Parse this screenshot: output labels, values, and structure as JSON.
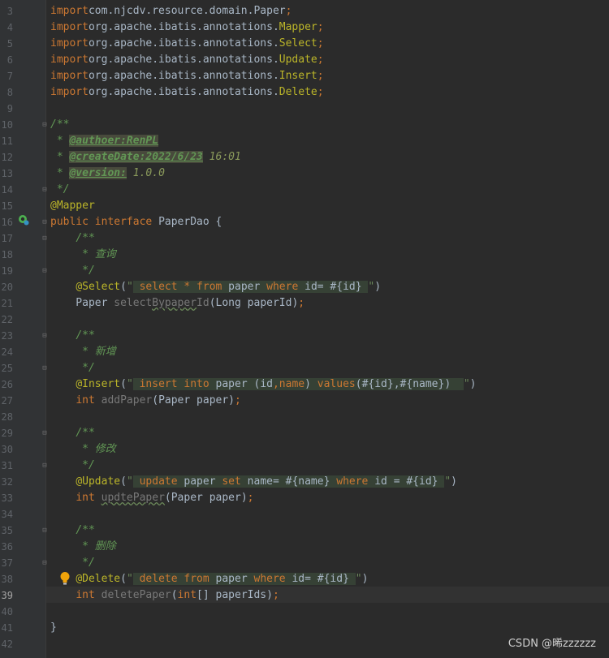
{
  "editor": {
    "lines": [
      {
        "n": "3",
        "parts": [
          [
            "kw",
            "import"
          ],
          [
            "",
            "com.njcdv.resource.domain.Paper"
          ],
          [
            "kw",
            ";"
          ]
        ]
      },
      {
        "n": "4",
        "parts": [
          [
            "kw",
            "import"
          ],
          [
            "",
            "org.apache.ibatis.annotations."
          ],
          [
            "ann",
            "Mapper"
          ],
          [
            "kw",
            ";"
          ]
        ]
      },
      {
        "n": "5",
        "parts": [
          [
            "kw",
            "import"
          ],
          [
            "",
            "org.apache.ibatis.annotations."
          ],
          [
            "ann",
            "Select"
          ],
          [
            "kw",
            ";"
          ]
        ]
      },
      {
        "n": "6",
        "parts": [
          [
            "kw",
            "import"
          ],
          [
            "",
            "org.apache.ibatis.annotations."
          ],
          [
            "ann",
            "Update"
          ],
          [
            "kw",
            ";"
          ]
        ]
      },
      {
        "n": "7",
        "parts": [
          [
            "kw",
            "import"
          ],
          [
            "",
            "org.apache.ibatis.annotations."
          ],
          [
            "ann",
            "Insert"
          ],
          [
            "kw",
            ";"
          ]
        ]
      },
      {
        "n": "8",
        "parts": [
          [
            "kw",
            "import"
          ],
          [
            "",
            "org.apache.ibatis.annotations."
          ],
          [
            "ann",
            "Delete"
          ],
          [
            "kw",
            ";"
          ]
        ]
      },
      {
        "n": "9",
        "parts": []
      },
      {
        "n": "10",
        "fold": true,
        "parts": [
          [
            "doc",
            "/**"
          ]
        ]
      },
      {
        "n": "11",
        "parts": [
          [
            "doc",
            " * "
          ],
          [
            "doctag",
            "@authoer:RenPL"
          ]
        ]
      },
      {
        "n": "12",
        "parts": [
          [
            "doc",
            " * "
          ],
          [
            "doctag",
            "@createDate:2022/6/23"
          ],
          [
            "docval",
            " 16:01"
          ]
        ]
      },
      {
        "n": "13",
        "parts": [
          [
            "doc",
            " * "
          ],
          [
            "doctag",
            "@version:"
          ],
          [
            "docval",
            " 1.0.0"
          ]
        ]
      },
      {
        "n": "14",
        "fold": true,
        "parts": [
          [
            "doc",
            " */"
          ]
        ]
      },
      {
        "n": "15",
        "parts": [
          [
            "ann",
            "@Mapper"
          ]
        ]
      },
      {
        "n": "16",
        "fold": true,
        "parts": [
          [
            "kw",
            "public interface "
          ],
          [
            "",
            "PaperDao {"
          ]
        ]
      },
      {
        "n": "17",
        "fold": true,
        "parts": [
          [
            "",
            "    "
          ],
          [
            "doc",
            "/**"
          ]
        ]
      },
      {
        "n": "18",
        "parts": [
          [
            "",
            "    "
          ],
          [
            "doc",
            " * 查询"
          ]
        ]
      },
      {
        "n": "19",
        "fold": true,
        "parts": [
          [
            "",
            "    "
          ],
          [
            "doc",
            " */"
          ]
        ]
      },
      {
        "n": "20",
        "parts": [
          [
            "",
            "    "
          ],
          [
            "ann",
            "@Select"
          ],
          [
            "",
            "("
          ],
          [
            "str",
            "\""
          ],
          [
            "inj",
            " select * from paper where id= #{id} "
          ],
          [
            "str",
            "\""
          ],
          [
            "",
            ")"
          ]
        ]
      },
      {
        "n": "21",
        "parts": [
          [
            "",
            "    Paper "
          ],
          [
            "dim",
            "select"
          ],
          [
            "dimsq",
            "Bypaper"
          ],
          [
            "dim",
            "Id"
          ],
          [
            "",
            "(Long paperId)"
          ],
          [
            "kw",
            ";"
          ]
        ]
      },
      {
        "n": "22",
        "parts": []
      },
      {
        "n": "23",
        "fold": true,
        "parts": [
          [
            "",
            "    "
          ],
          [
            "doc",
            "/**"
          ]
        ]
      },
      {
        "n": "24",
        "parts": [
          [
            "",
            "    "
          ],
          [
            "doc",
            " * 新增"
          ]
        ]
      },
      {
        "n": "25",
        "fold": true,
        "parts": [
          [
            "",
            "    "
          ],
          [
            "doc",
            " */"
          ]
        ]
      },
      {
        "n": "26",
        "parts": [
          [
            "",
            "    "
          ],
          [
            "ann",
            "@Insert"
          ],
          [
            "",
            "("
          ],
          [
            "str",
            "\""
          ],
          [
            "inj",
            " insert into paper (id,name) values(#{id},#{name})  "
          ],
          [
            "str",
            "\""
          ],
          [
            "",
            ")"
          ]
        ]
      },
      {
        "n": "27",
        "parts": [
          [
            "",
            "    "
          ],
          [
            "kw",
            "int "
          ],
          [
            "dim",
            "addPaper"
          ],
          [
            "",
            "(Paper paper)"
          ],
          [
            "kw",
            ";"
          ]
        ]
      },
      {
        "n": "28",
        "parts": []
      },
      {
        "n": "29",
        "fold": true,
        "parts": [
          [
            "",
            "    "
          ],
          [
            "doc",
            "/**"
          ]
        ]
      },
      {
        "n": "30",
        "parts": [
          [
            "",
            "    "
          ],
          [
            "doc",
            " * 修改"
          ]
        ]
      },
      {
        "n": "31",
        "fold": true,
        "parts": [
          [
            "",
            "    "
          ],
          [
            "doc",
            " */"
          ]
        ]
      },
      {
        "n": "32",
        "parts": [
          [
            "",
            "    "
          ],
          [
            "ann",
            "@Update"
          ],
          [
            "",
            "("
          ],
          [
            "str",
            "\""
          ],
          [
            "inj",
            " update paper set name= #{name} where id = #{id} "
          ],
          [
            "str",
            "\""
          ],
          [
            "",
            ")"
          ]
        ]
      },
      {
        "n": "33",
        "parts": [
          [
            "",
            "    "
          ],
          [
            "kw",
            "int "
          ],
          [
            "dimsq",
            "updtePaper"
          ],
          [
            "",
            "(Paper paper)"
          ],
          [
            "kw",
            ";"
          ]
        ]
      },
      {
        "n": "34",
        "parts": []
      },
      {
        "n": "35",
        "fold": true,
        "parts": [
          [
            "",
            "    "
          ],
          [
            "doc",
            "/**"
          ]
        ]
      },
      {
        "n": "36",
        "parts": [
          [
            "",
            "    "
          ],
          [
            "doc",
            " * 删除"
          ]
        ]
      },
      {
        "n": "37",
        "fold": true,
        "parts": [
          [
            "",
            "    "
          ],
          [
            "doc",
            " */"
          ]
        ]
      },
      {
        "n": "38",
        "parts": [
          [
            "",
            "    "
          ],
          [
            "ann",
            "@Delete"
          ],
          [
            "",
            "("
          ],
          [
            "str",
            "\""
          ],
          [
            "inj",
            " delete from paper where id= #{id} "
          ],
          [
            "str",
            "\""
          ],
          [
            "",
            ")"
          ]
        ]
      },
      {
        "n": "39",
        "current": true,
        "parts": [
          [
            "",
            "    "
          ],
          [
            "kw",
            "int "
          ],
          [
            "dim",
            "deletePaper"
          ],
          [
            "",
            "("
          ],
          [
            "kw",
            "int"
          ],
          [
            "",
            "[] paperIds)"
          ],
          [
            "kw",
            ";"
          ]
        ]
      },
      {
        "n": "40",
        "parts": []
      },
      {
        "n": "41",
        "parts": [
          [
            "",
            "}"
          ]
        ]
      },
      {
        "n": "42",
        "parts": []
      }
    ]
  },
  "icons": {
    "gutter_icon": "spring-bean-icon",
    "intention_icon": "lightbulb-icon"
  },
  "colors": {
    "background": "#2b2b2b",
    "gutter": "#313335",
    "keyword": "#cc7832",
    "annotation": "#bbb529",
    "doc": "#629755",
    "string": "#6a8759"
  },
  "watermark": "CSDN @晞zzzzzz"
}
